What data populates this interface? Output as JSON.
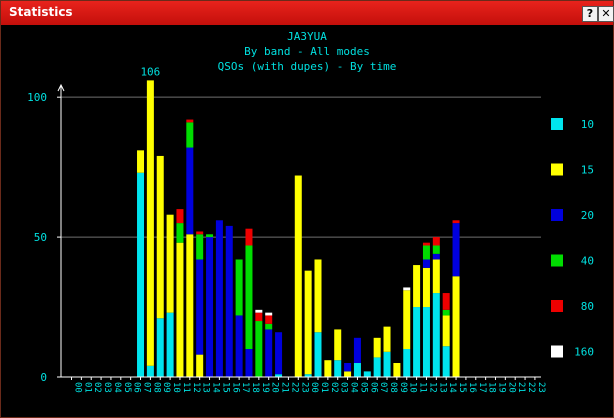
{
  "window": {
    "title": "Statistics",
    "help_label": "?",
    "close_label": "✕"
  },
  "colors": {
    "background": "#000000",
    "text": "#00e0e0",
    "grid": "#707070",
    "band_10": "#00e5ee",
    "band_15": "#ffff00",
    "band_20": "#0000dd",
    "band_40": "#00dd00",
    "band_80": "#ee0000",
    "band_160": "#ffffff"
  },
  "chart_data": {
    "type": "bar",
    "stacked": true,
    "title": "JA3YUA",
    "subtitle1": "By band - All modes",
    "subtitle2": "QSOs (with dupes) - By time",
    "ylim": [
      0,
      100
    ],
    "yticks": [
      "0",
      "50",
      "100"
    ],
    "peak_label": "106",
    "grid": true,
    "legend": "right",
    "categories": [
      "00",
      "01",
      "02",
      "03",
      "04",
      "05",
      "06",
      "07",
      "08",
      "09",
      "10",
      "11",
      "12",
      "13",
      "14",
      "15",
      "16",
      "17",
      "18",
      "19",
      "20",
      "21",
      "22",
      "23",
      "00",
      "01",
      "02",
      "03",
      "04",
      "05",
      "06",
      "07",
      "08",
      "09",
      "10",
      "11",
      "12",
      "13",
      "14",
      "15",
      "16",
      "17",
      "18",
      "19",
      "20",
      "21",
      "22",
      "23"
    ],
    "series": [
      {
        "name": "10",
        "color": "#00e5ee",
        "values": [
          0,
          0,
          0,
          0,
          0,
          0,
          0,
          73,
          4,
          21,
          23,
          0,
          0,
          0,
          0,
          0,
          0,
          0,
          0,
          0,
          0,
          1,
          0,
          0,
          1,
          16,
          0,
          6,
          0,
          5,
          2,
          7,
          9,
          0,
          10,
          25,
          25,
          30,
          11,
          0,
          0,
          0,
          0,
          0,
          0,
          0,
          0,
          0
        ]
      },
      {
        "name": "15",
        "color": "#ffff00",
        "values": [
          0,
          0,
          0,
          0,
          0,
          0,
          0,
          8,
          102,
          58,
          35,
          48,
          51,
          8,
          0,
          0,
          0,
          0,
          0,
          0,
          0,
          0,
          0,
          72,
          37,
          26,
          6,
          11,
          2,
          0,
          0,
          7,
          9,
          5,
          21,
          15,
          14,
          12,
          11,
          36,
          0,
          0,
          0,
          0,
          0,
          0,
          0,
          0
        ]
      },
      {
        "name": "20",
        "color": "#0000dd",
        "values": [
          0,
          0,
          0,
          0,
          0,
          0,
          0,
          0,
          0,
          0,
          0,
          0,
          31,
          34,
          50,
          56,
          54,
          22,
          10,
          0,
          17,
          15,
          0,
          0,
          0,
          0,
          0,
          0,
          3,
          9,
          0,
          0,
          0,
          0,
          0,
          0,
          3,
          2,
          0,
          19,
          0,
          0,
          0,
          0,
          0,
          0,
          0,
          0
        ]
      },
      {
        "name": "40",
        "color": "#00dd00",
        "values": [
          0,
          0,
          0,
          0,
          0,
          0,
          0,
          0,
          0,
          0,
          0,
          7,
          9,
          9,
          1,
          0,
          0,
          20,
          37,
          20,
          2,
          0,
          0,
          0,
          0,
          0,
          0,
          0,
          0,
          0,
          0,
          0,
          0,
          0,
          0,
          0,
          5,
          3,
          2,
          0,
          0,
          0,
          0,
          0,
          0,
          0,
          0,
          0
        ]
      },
      {
        "name": "80",
        "color": "#ee0000",
        "values": [
          0,
          0,
          0,
          0,
          0,
          0,
          0,
          0,
          0,
          0,
          0,
          5,
          1,
          1,
          0,
          0,
          0,
          0,
          6,
          3,
          3,
          0,
          0,
          0,
          0,
          0,
          0,
          0,
          0,
          0,
          0,
          0,
          0,
          0,
          0,
          0,
          1,
          3,
          6,
          1,
          0,
          0,
          0,
          0,
          0,
          0,
          0,
          0
        ]
      },
      {
        "name": "160",
        "color": "#ffffff",
        "values": [
          0,
          0,
          0,
          0,
          0,
          0,
          0,
          0,
          0,
          0,
          0,
          0,
          0,
          0,
          0,
          0,
          0,
          0,
          0,
          1,
          1,
          0,
          0,
          0,
          0,
          0,
          0,
          0,
          0,
          0,
          0,
          0,
          0,
          0,
          1,
          0,
          0,
          0,
          0,
          0,
          0,
          0,
          0,
          0,
          0,
          0,
          0,
          0
        ]
      }
    ]
  }
}
